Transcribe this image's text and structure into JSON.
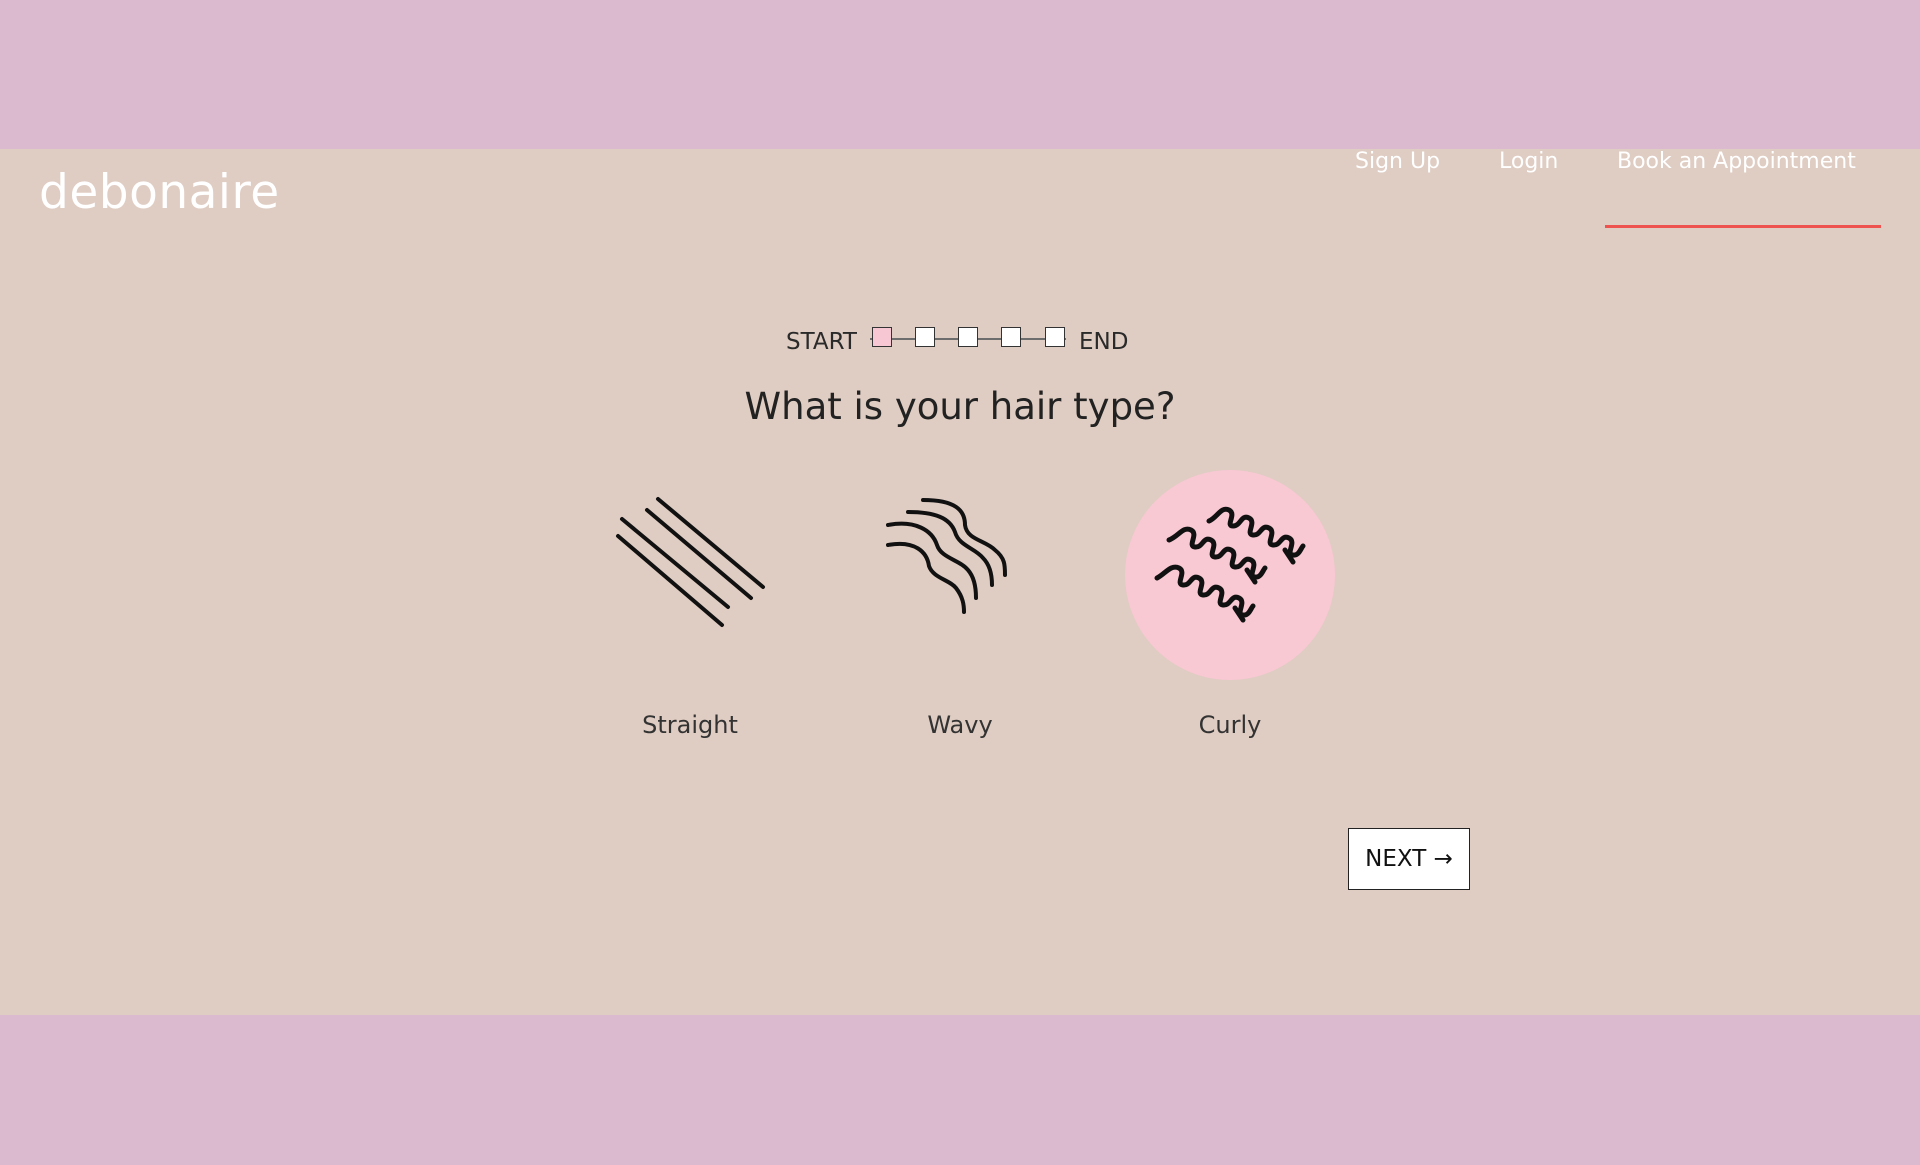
{
  "brand": {
    "logo_text": "debonaire"
  },
  "nav": {
    "items": [
      {
        "label": "Sign Up"
      },
      {
        "label": "Login"
      },
      {
        "label": "Book an Appointment",
        "active": true
      }
    ]
  },
  "progress": {
    "start_label": "START",
    "end_label": "END",
    "total_steps": 5,
    "current_step": 1
  },
  "question": {
    "text": "What is your hair type?"
  },
  "options": [
    {
      "label": "Straight",
      "icon": "straight-hair-icon",
      "selected": false
    },
    {
      "label": "Wavy",
      "icon": "wavy-hair-icon",
      "selected": false
    },
    {
      "label": "Curly",
      "icon": "curly-hair-icon",
      "selected": true
    }
  ],
  "next_button": {
    "label": "NEXT →"
  },
  "colors": {
    "band": "#dbb9cf",
    "page_bg": "#dfccc2",
    "selected_circle": "#f8c8d3",
    "nav_underline": "#ef5350"
  }
}
